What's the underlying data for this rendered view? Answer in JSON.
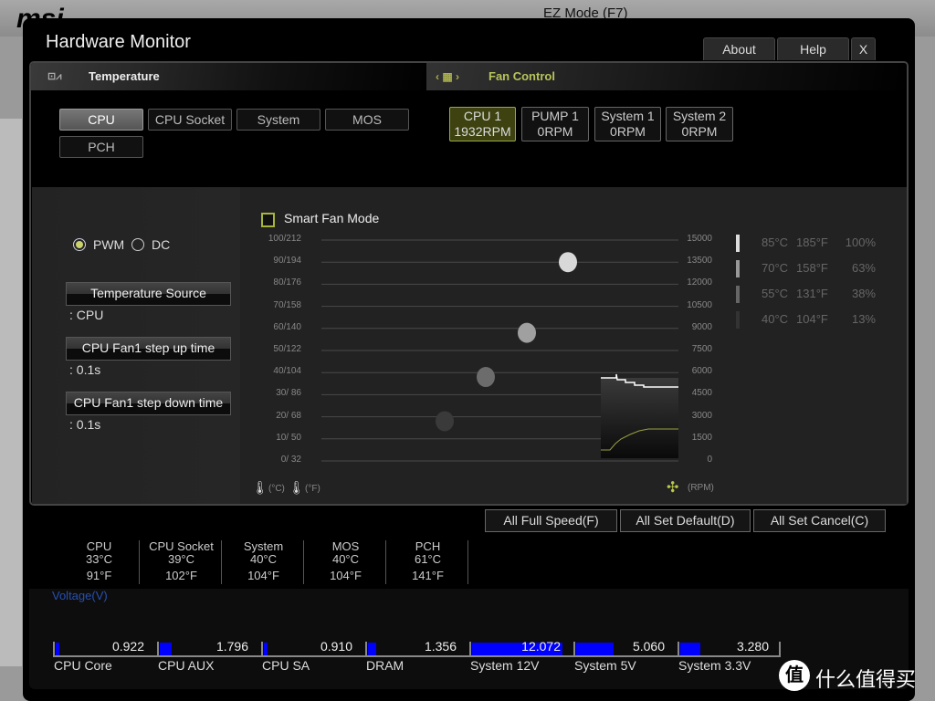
{
  "background": {
    "logo": "msi",
    "ez_mode": "EZ Mode (F7)"
  },
  "window": {
    "title": "Hardware Monitor",
    "buttons": [
      "About",
      "Help",
      "X"
    ]
  },
  "sections": {
    "temperature": "Temperature",
    "fan_control": "Fan Control"
  },
  "temp_sources": [
    {
      "label": "CPU",
      "selected": true
    },
    {
      "label": "CPU Socket"
    },
    {
      "label": "System"
    },
    {
      "label": "MOS"
    },
    {
      "label": "PCH"
    }
  ],
  "fans": [
    {
      "name": "CPU 1",
      "rpm": "1932RPM",
      "selected": true
    },
    {
      "name": "PUMP 1",
      "rpm": "0RPM"
    },
    {
      "name": "System 1",
      "rpm": "0RPM"
    },
    {
      "name": "System 2",
      "rpm": "0RPM"
    }
  ],
  "mode": {
    "pwm": "PWM",
    "dc": "DC",
    "selected": "PWM"
  },
  "settings": [
    {
      "label": "Temperature Source",
      "value": ": CPU"
    },
    {
      "label": "CPU Fan1 step up time",
      "value": ": 0.1s"
    },
    {
      "label": "CPU Fan1 step down time",
      "value": ": 0.1s"
    }
  ],
  "smart_fan": {
    "label": "Smart Fan Mode",
    "checked": false
  },
  "chart_data": {
    "type": "scatter",
    "left_ticks": [
      "100/212",
      "90/194",
      "80/176",
      "70/158",
      "60/140",
      "50/122",
      "40/104",
      "30/  86",
      "20/  68",
      "10/  50",
      "0/  32"
    ],
    "right_ticks": [
      "15000",
      "13500",
      "12000",
      "10500",
      "9000",
      "7500",
      "6000",
      "4500",
      "3000",
      "1500",
      "0"
    ],
    "ylim": [
      0,
      100
    ],
    "points": [
      {
        "temp_c": 85,
        "y": 90,
        "color": "#d8d8d8"
      },
      {
        "temp_c": 70,
        "y": 58,
        "color": "#a0a0a0"
      },
      {
        "temp_c": 55,
        "y": 38,
        "color": "#6c6c6c"
      },
      {
        "temp_c": 40,
        "y": 18,
        "color": "#3a3a3a"
      }
    ],
    "left_unit_c": "(°C)",
    "left_unit_f": "(°F)",
    "right_unit": "(RPM)",
    "steps": [
      {
        "c": "85°C",
        "f": "185°F",
        "pct": "100%",
        "color": "#dddddd"
      },
      {
        "c": "70°C",
        "f": "158°F",
        "pct": "63%",
        "color": "#999999"
      },
      {
        "c": "55°C",
        "f": "131°F",
        "pct": "38%",
        "color": "#666666"
      },
      {
        "c": "40°C",
        "f": "104°F",
        "pct": "13%",
        "color": "#333333"
      }
    ]
  },
  "actions": [
    "All Full Speed(F)",
    "All Set Default(D)",
    "All Set Cancel(C)"
  ],
  "temps": [
    {
      "name": "CPU",
      "c": "33°C",
      "f": "91°F"
    },
    {
      "name": "CPU Socket",
      "c": "39°C",
      "f": "102°F"
    },
    {
      "name": "System",
      "c": "40°C",
      "f": "104°F"
    },
    {
      "name": "MOS",
      "c": "40°C",
      "f": "104°F"
    },
    {
      "name": "PCH",
      "c": "61°C",
      "f": "141°F"
    }
  ],
  "voltage": {
    "title": "Voltage(V)",
    "bar_color": "#0000ff",
    "items": [
      {
        "name": "CPU Core",
        "value": "0.922",
        "fill": 0.04
      },
      {
        "name": "CPU AUX",
        "value": "1.796",
        "fill": 0.12
      },
      {
        "name": "CPU SA",
        "value": "0.910",
        "fill": 0.04
      },
      {
        "name": "DRAM",
        "value": "1.356",
        "fill": 0.08
      },
      {
        "name": "System 12V",
        "value": "12.072",
        "fill": 0.9
      },
      {
        "name": "System 5V",
        "value": "5.060",
        "fill": 0.37
      },
      {
        "name": "System 3.3V",
        "value": "3.280",
        "fill": 0.2
      }
    ]
  },
  "watermark": "什么值得买"
}
